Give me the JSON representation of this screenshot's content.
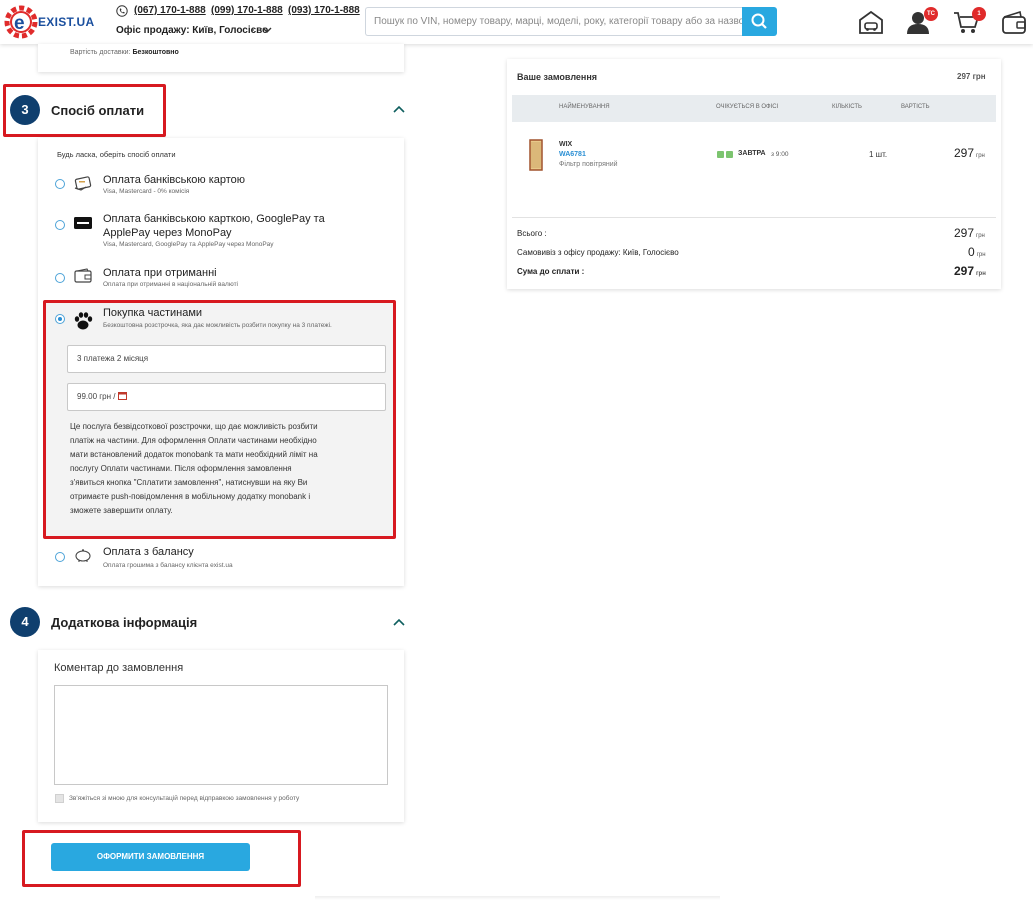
{
  "header": {
    "logo_text": "EXIST.UA",
    "phones": [
      "(067) 170-1-888",
      "(099) 170-1-888",
      "(093) 170-1-888"
    ],
    "office_label": "Офіс продажу: Київ, Голосієво",
    "search_placeholder": "Пошук по VIN, номеру товару, марці, моделі, року, категорії товару або за назво...",
    "profile_badge": "TC",
    "cart_badge": "1",
    "colors": {
      "accent": "#29a8e0",
      "brand": "#1a4f9e",
      "badge": "#e02b2b"
    }
  },
  "delivery": {
    "cost_label": "Вартість доставки:",
    "cost_value": "Безкоштовно"
  },
  "payment_section": {
    "number": "3",
    "title": "Спосіб оплати",
    "prompt": "Будь ласка, оберіть спосіб оплати",
    "options": [
      {
        "title": "Оплата банківською картою",
        "subtitle": "Visa, Mastercard - 0% комісія",
        "icon": "card-hand-icon",
        "selected": false
      },
      {
        "title": "Оплата банківською карткою, GooglePay та ApplePay через MonoPay",
        "subtitle": "Visa, Mastercard, GooglePay та ApplePay через MonoPay",
        "icon": "monopay-card-icon",
        "selected": false
      },
      {
        "title": "Оплата при отриманні",
        "subtitle": "Оплата при отриманні в національній валюті",
        "icon": "wallet-icon",
        "selected": false
      },
      {
        "title": "Покупка частинами",
        "subtitle": "Безкоштовна розстрочка, яка дає можливість розбити покупку на 3 платежі.",
        "icon": "paw-icon",
        "selected": true
      },
      {
        "title": "Оплата з балансу",
        "subtitle": "Оплата грошима з балансу клієнта exist.ua",
        "icon": "piggy-bank-icon",
        "selected": false
      }
    ],
    "installment": {
      "plan_value": "3 платежа 2 місяця",
      "amount_value": "99.00 грн /",
      "info_lines": [
        "Це послуга безвідсоткової розстрочки, що дає можливість розбити",
        "платіж на частини. Для оформлення Оплати частинами необхідно",
        "мати встановлений додаток monobank та мати необхідний ліміт на",
        "послугу Оплати частинами. Після оформлення замовлення",
        "з'явиться кнопка \"Сплатити замовлення\", натиснувши на яку Ви",
        "отримаєте push-повідомлення в мобільному додатку monobank і",
        "зможете завершити оплату."
      ]
    }
  },
  "additional_section": {
    "number": "4",
    "title": "Додаткова інформація",
    "comment_label": "Коментар до замовлення",
    "comment_value": "",
    "consult_label": "Зв'яжіться зі мною для консультацій перед відправкою замовлення у роботу"
  },
  "submit_label": "ОФОРМИТИ ЗАМОВЛЕННЯ",
  "order": {
    "title": "Ваше замовлення",
    "total_header": "297 грн",
    "columns": [
      "НАЙМЕНУВАННЯ",
      "ОЧІКУЄТЬСЯ В ОФІСІ",
      "КІЛЬКІСТЬ",
      "ВАРТІСТЬ"
    ],
    "item": {
      "brand": "WIX",
      "code": "WA6781",
      "name": "Фільтр повітряний",
      "eta_day": "ЗАВТРА",
      "eta_time": "з 9:00",
      "qty": "1 шт.",
      "price": "297",
      "currency": "грн"
    },
    "summary": {
      "total_label": "Всього :",
      "total_value": "297",
      "pickup_label": "Самовивіз з офісу продажу: Київ, Голосієво",
      "pickup_value": "0",
      "due_label": "Сума до сплати :",
      "due_value": "297",
      "currency": "грн"
    }
  }
}
